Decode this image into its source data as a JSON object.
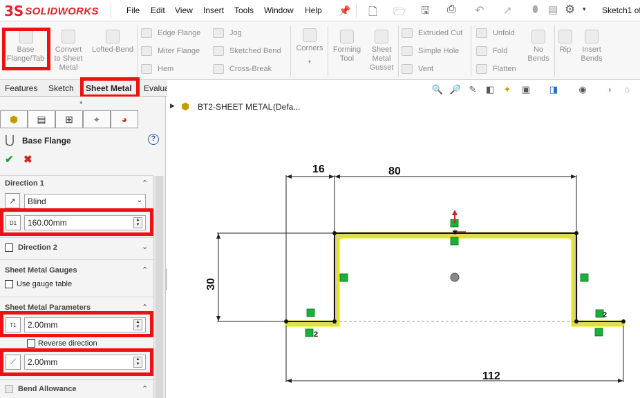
{
  "app": {
    "logo_prefix": "3S",
    "logo_brand": "SOLIDWORKS",
    "title": "Sketch1 of"
  },
  "menu": [
    "File",
    "Edit",
    "View",
    "Insert",
    "Tools",
    "Window",
    "Help"
  ],
  "ribbon": {
    "base_flange": "Base Flange/Tab",
    "convert": "Convert to Sheet Metal",
    "lofted_bend": "Lofted-Bend",
    "edge_flange": "Edge Flange",
    "miter_flange": "Miter Flange",
    "hem": "Hem",
    "jog": "Jog",
    "sketched_bend": "Sketched Bend",
    "cross_break": "Cross-Break",
    "corners": "Corners",
    "forming_tool": "Forming Tool",
    "sheet_metal_gusset": "Sheet Metal Gusset",
    "extruded_cut": "Extruded Cut",
    "simple_hole": "Simple Hole",
    "vent": "Vent",
    "unfold": "Unfold",
    "fold": "Fold",
    "flatten": "Flatten",
    "no_bends": "No Bends",
    "rip": "Rip",
    "insert_bends": "Insert Bends"
  },
  "cm_tabs": [
    "Features",
    "Sketch",
    "Sheet Metal",
    "Evaluate"
  ],
  "feature": {
    "title": "Base Flange"
  },
  "direction1": {
    "label": "Direction 1",
    "end_condition": "Blind",
    "depth": "160.00mm",
    "depth_icon": "D1"
  },
  "direction2": {
    "label": "Direction 2"
  },
  "gauges": {
    "label": "Sheet Metal Gauges",
    "use_gauge_table": "Use gauge table"
  },
  "params": {
    "label": "Sheet Metal Parameters",
    "thickness": "2.00mm",
    "thickness_icon": "T1",
    "reverse_direction": "Reverse direction",
    "bend_radius": "2.00mm"
  },
  "bend_allowance": {
    "label": "Bend Allowance"
  },
  "tree": {
    "part": "BT2-SHEET METAL",
    "config": "(Defa..."
  },
  "dimensions": {
    "left_flange": "16",
    "top_width": "80",
    "height": "30",
    "overall": "112"
  },
  "relations": {
    "bend_label_left": "2",
    "bend_label_right": "2"
  },
  "colors": {
    "highlight": "#ee1111",
    "accent_tab": "#ee1111",
    "relation_green": "#18b03a",
    "profile_fill": "#d8d8a8",
    "profile_outline": "#eeee00"
  }
}
